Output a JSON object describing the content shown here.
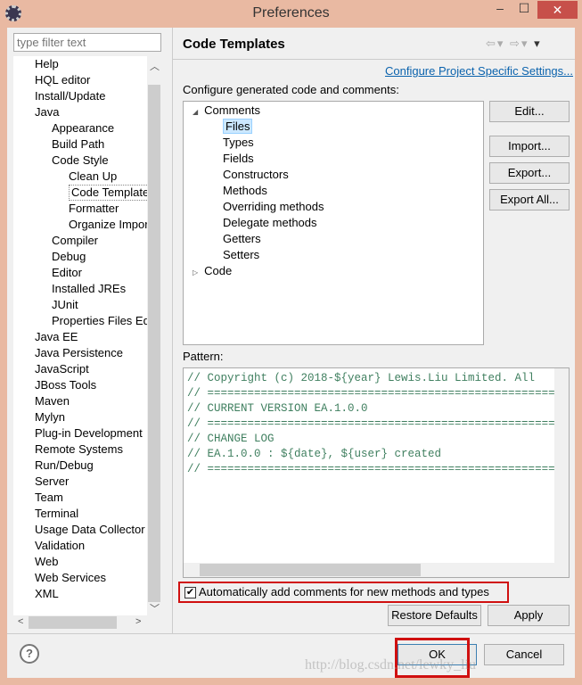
{
  "window": {
    "title": "Preferences",
    "minimize": "–",
    "maximize": "☐",
    "close": "✕"
  },
  "sidebar": {
    "filter_placeholder": "type filter text",
    "items": [
      {
        "label": "Help",
        "level": 0
      },
      {
        "label": "HQL editor",
        "level": 0
      },
      {
        "label": "Install/Update",
        "level": 0
      },
      {
        "label": "Java",
        "level": 0
      },
      {
        "label": "Appearance",
        "level": 1
      },
      {
        "label": "Build Path",
        "level": 1
      },
      {
        "label": "Code Style",
        "level": 1
      },
      {
        "label": "Clean Up",
        "level": 2
      },
      {
        "label": "Code Templates",
        "level": 2,
        "selected": true
      },
      {
        "label": "Formatter",
        "level": 2
      },
      {
        "label": "Organize Imports",
        "level": 2
      },
      {
        "label": "Compiler",
        "level": 1
      },
      {
        "label": "Debug",
        "level": 1
      },
      {
        "label": "Editor",
        "level": 1
      },
      {
        "label": "Installed JREs",
        "level": 1
      },
      {
        "label": "JUnit",
        "level": 1
      },
      {
        "label": "Properties Files Editor",
        "level": 1
      },
      {
        "label": "Java EE",
        "level": 0
      },
      {
        "label": "Java Persistence",
        "level": 0
      },
      {
        "label": "JavaScript",
        "level": 0
      },
      {
        "label": "JBoss Tools",
        "level": 0
      },
      {
        "label": "Maven",
        "level": 0
      },
      {
        "label": "Mylyn",
        "level": 0
      },
      {
        "label": "Plug-in Development",
        "level": 0
      },
      {
        "label": "Remote Systems",
        "level": 0
      },
      {
        "label": "Run/Debug",
        "level": 0
      },
      {
        "label": "Server",
        "level": 0
      },
      {
        "label": "Team",
        "level": 0
      },
      {
        "label": "Terminal",
        "level": 0
      },
      {
        "label": "Usage Data Collector",
        "level": 0
      },
      {
        "label": "Validation",
        "level": 0
      },
      {
        "label": "Web",
        "level": 0
      },
      {
        "label": "Web Services",
        "level": 0
      },
      {
        "label": "XML",
        "level": 0
      }
    ]
  },
  "main": {
    "title": "Code Templates",
    "project_link": "Configure Project Specific Settings...",
    "configure_label": "Configure generated code and comments:",
    "tree": [
      {
        "label": "Comments",
        "level": 0,
        "expander": "◢"
      },
      {
        "label": "Files",
        "level": 1,
        "selected": true
      },
      {
        "label": "Types",
        "level": 1
      },
      {
        "label": "Fields",
        "level": 1
      },
      {
        "label": "Constructors",
        "level": 1
      },
      {
        "label": "Methods",
        "level": 1
      },
      {
        "label": "Overriding methods",
        "level": 1
      },
      {
        "label": "Delegate methods",
        "level": 1
      },
      {
        "label": "Getters",
        "level": 1
      },
      {
        "label": "Setters",
        "level": 1
      },
      {
        "label": "Code",
        "level": 0,
        "expander": "▷"
      }
    ],
    "buttons": {
      "edit": "Edit...",
      "import": "Import...",
      "export": "Export...",
      "export_all": "Export All..."
    },
    "pattern_label": "Pattern:",
    "pattern": "// Copyright (c) 2018-${year} Lewis.Liu Limited. All\n// ======================================================\n// CURRENT VERSION EA.1.0.0\n// ======================================================\n// CHANGE LOG\n// EA.1.0.0 : ${date}, ${user} created\n// ======================================================",
    "auto_comments": {
      "label": "Automatically add comments for new methods and types",
      "checked": true
    },
    "restore_defaults": "Restore Defaults",
    "apply": "Apply"
  },
  "footer": {
    "help": "?",
    "ok": "OK",
    "cancel": "Cancel"
  },
  "watermark": "http://blog.csdn.net/lewky_liu",
  "colors": {
    "highlight": "#d01010",
    "link": "#0b63ad",
    "code": "#3f7f5f"
  }
}
